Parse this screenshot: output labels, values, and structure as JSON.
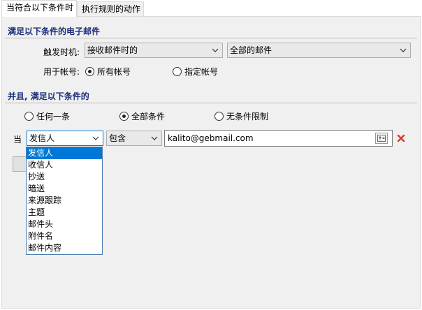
{
  "tabs": [
    {
      "label": "当符合以下条件时",
      "active": true
    },
    {
      "label": "执行规则的动作",
      "active": false
    }
  ],
  "section1": {
    "title": "满足以下条件的电子邮件",
    "trigger_label": "触发时机:",
    "trigger_value": "接收邮件时的",
    "scope_value": "全部的邮件",
    "account_label": "用于帐号:",
    "account_options": [
      {
        "label": "所有帐号",
        "selected": true
      },
      {
        "label": "指定帐号",
        "selected": false
      }
    ]
  },
  "section2": {
    "title": "并且, 满足以下条件的",
    "match_options": [
      {
        "label": "任何一条",
        "selected": false
      },
      {
        "label": "全部条件",
        "selected": true
      },
      {
        "label": "无条件限制",
        "selected": false
      }
    ]
  },
  "condition": {
    "prefix": "当",
    "field_value": "发信人",
    "operator_value": "包含",
    "text_value": "kalito@gebmail.com"
  },
  "field_dropdown": {
    "options": [
      "发信人",
      "收信人",
      "抄送",
      "暗送",
      "来源跟踪",
      "主题",
      "邮件头",
      "附件名",
      "邮件内容"
    ],
    "selected_index": 0
  },
  "icons": {
    "combo_arrow": "chevron-down-icon",
    "address_book": "address-book-icon",
    "delete": "delete-x-icon"
  },
  "colors": {
    "section_title": "#1c2d7a",
    "selection": "#0078d7",
    "delete_red": "#d9372b"
  }
}
